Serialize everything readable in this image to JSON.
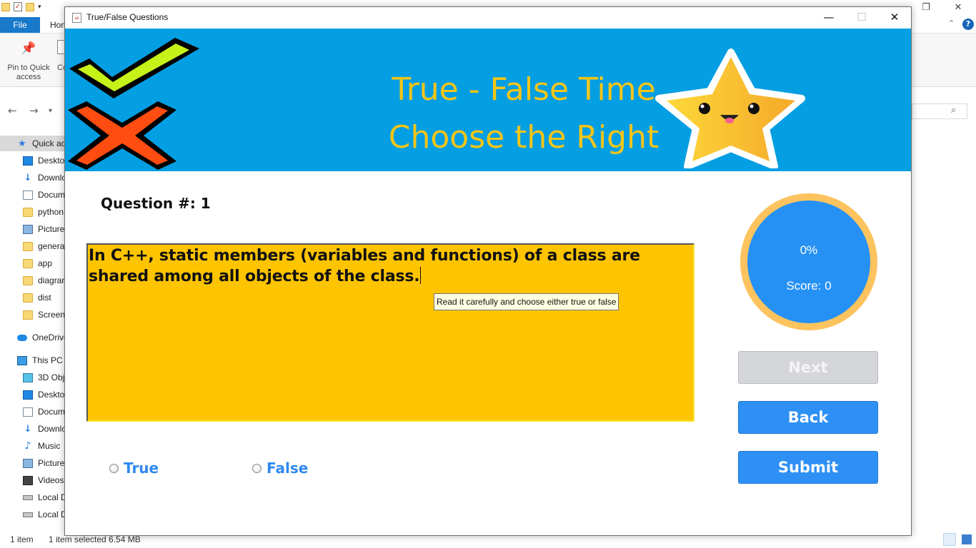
{
  "explorer": {
    "file_tab": "File",
    "home_tab": "Hom",
    "pin_label": "Pin to Quick access",
    "copy_label": "Co",
    "nav_items": [
      {
        "label": "Quick ac",
        "icon": "quick-access-star-icon"
      },
      {
        "label": "Deskto",
        "icon": "desktop-icon"
      },
      {
        "label": "Downlo",
        "icon": "downloads-icon"
      },
      {
        "label": "Docum",
        "icon": "documents-icon"
      },
      {
        "label": "python",
        "icon": "folder-icon"
      },
      {
        "label": "Picture",
        "icon": "pictures-icon"
      },
      {
        "label": "genera",
        "icon": "folder-icon"
      },
      {
        "label": "app",
        "icon": "folder-icon"
      },
      {
        "label": "diagrar",
        "icon": "folder-icon"
      },
      {
        "label": "dist",
        "icon": "folder-icon"
      },
      {
        "label": "Screens",
        "icon": "folder-icon"
      },
      {
        "label": "OneDrive",
        "icon": "onedrive-icon"
      },
      {
        "label": "This PC",
        "icon": "this-pc-icon"
      },
      {
        "label": "3D Obj",
        "icon": "3d-objects-icon"
      },
      {
        "label": "Deskto",
        "icon": "desktop-icon"
      },
      {
        "label": "Docum",
        "icon": "documents-icon"
      },
      {
        "label": "Downlo",
        "icon": "downloads-icon"
      },
      {
        "label": "Music",
        "icon": "music-icon"
      },
      {
        "label": "Picture",
        "icon": "pictures-icon"
      },
      {
        "label": "Videos",
        "icon": "videos-icon"
      },
      {
        "label": "Local D",
        "icon": "local-disk-icon"
      },
      {
        "label": "Local D",
        "icon": "local-disk-icon"
      }
    ],
    "status_items": "1 item",
    "status_selected": "1 item selected  6.54 MB"
  },
  "app": {
    "window_title": "True/False Questions",
    "banner_line1": "True - False Time",
    "banner_line2": "Choose the Right",
    "question_number_label": "Question #: 1",
    "question_text": "In C++, static members (variables and functions) of a class are shared among all objects of the class.",
    "tooltip": "Read it carefully and choose either true or false",
    "options": [
      "True",
      "False"
    ],
    "selected_option": null,
    "progress_percent": "0%",
    "progress_value": 0,
    "score_label": "Score: 0",
    "buttons": {
      "next": "Next",
      "back": "Back",
      "submit": "Submit"
    },
    "colors": {
      "banner": "#049ee3",
      "banner_text": "#f5c518",
      "question_bg": "#ffc400",
      "accent": "#2e90f5",
      "ring": "#fdc35e",
      "disabled": "#d4d6da"
    }
  }
}
